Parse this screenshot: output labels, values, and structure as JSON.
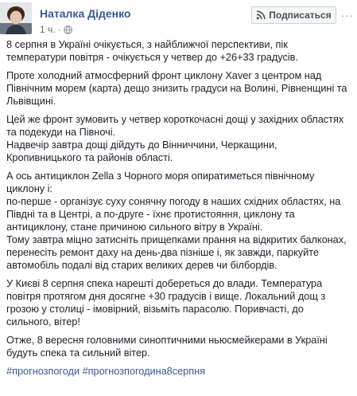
{
  "post": {
    "author": "Наталка Діденко",
    "time": "1 ч.",
    "subscribe_label": "Подписаться",
    "more_label": "···",
    "paragraphs": [
      [
        "8 серпня в Україні очікується, з найближчої перспективи, пік",
        "температури повітря - очікується у четвер до +26+33 градусів."
      ],
      [
        "Проте холодний атмосферний фронт циклону Xaver з центром над",
        "Північним морем (карта) дещо знизить градуси на Волині, Рівненщині та",
        "Львівщині."
      ],
      [
        "Цей же фронт зумовить у четвер короткочасні дощі у західних областях",
        "та подекуди на Півночі.",
        "Надвечір завтра дощі дійдуть до Вінниччини, Черкащини,",
        "Кропивницького та районів області."
      ],
      [
        "А ось антициклон Zella з Чорного моря опиратиметься північному",
        "циклону і:",
        "по-перше - організує суху сонячну погоду в наших східних областях, на",
        "Півдні та в Центрі, а по-друге - їхнє протистояння, циклону та",
        "антициклону, стане причиною сильного вітру в Україні.",
        "Тому завтра міцно затисніть прищепками прання на відкритих балконах,",
        "перенесіть ремонт даху на день-два пізніше і, як завжди, паркуйте",
        "автомобіль подалі від старих великих дерев чи білбордів."
      ],
      [
        "У Києві 8 серпня спека нарешті добереться до влади. Температура",
        "повітря протягом дня досягне +30 градусів і вище. Локальний дощ з",
        "грозою у столиці - імовірний, візьміть парасолю. Поривчасті, до",
        "сильного, вітер!"
      ],
      [
        "Отже, 8 вересня головними синоптичними ньюсмейкерами в Україні",
        "будуть спека та сильний вітер."
      ]
    ],
    "hashtags": [
      "#прогнозпогоди",
      "#прогнозпогодина8серпня"
    ],
    "colors": {
      "link": "#385898",
      "text": "#1d2129",
      "meta": "#616770",
      "button_bg": "#f5f6f7"
    },
    "icons": {
      "avatar": "avatar",
      "privacy": "globe-icon",
      "subscribe": "rss-icon",
      "more": "more-icon"
    }
  }
}
